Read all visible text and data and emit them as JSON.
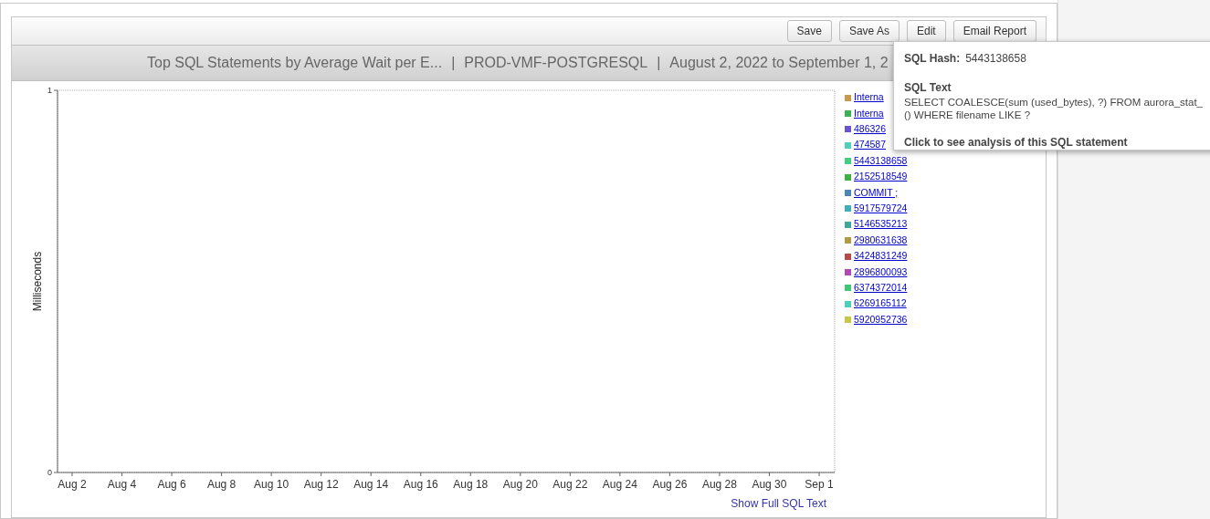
{
  "toolbar": {
    "buttons": [
      "Save",
      "Save As",
      "Edit",
      "Email Report"
    ]
  },
  "report_title": {
    "name": "Top SQL Statements by Average Wait per E...",
    "database": "PROD-VMF-POSTGRESQL",
    "range": "August 2, 2022 to September 1, 2",
    "separator": "|"
  },
  "chart": {
    "chart_data": {
      "type": "line",
      "ylabel": "Milliseconds",
      "categories": [
        "Aug 2",
        "Aug 4",
        "Aug 6",
        "Aug 8",
        "Aug 10",
        "Aug 12",
        "Aug 14",
        "Aug 16",
        "Aug 18",
        "Aug 20",
        "Aug 22",
        "Aug 24",
        "Aug 26",
        "Aug 28",
        "Aug 30",
        "Sep 1"
      ],
      "ylim": [
        0,
        1
      ],
      "yticks": [
        0,
        1
      ]
    }
  },
  "legend": [
    {
      "label": "Interna",
      "color": "#c89a4f"
    },
    {
      "label": "Interna",
      "color": "#3cb054"
    },
    {
      "label": "486326",
      "color": "#6a52d0"
    },
    {
      "label": "474587",
      "color": "#50d0b8"
    },
    {
      "label": "5443138658",
      "color": "#40d080"
    },
    {
      "label": "2152518549",
      "color": "#40b040"
    },
    {
      "label": "COMMIT ;",
      "color": "#4a86b8"
    },
    {
      "label": "5917579724",
      "color": "#40b0b8"
    },
    {
      "label": "5146535213",
      "color": "#40a898"
    },
    {
      "label": "2980631638",
      "color": "#b09a48"
    },
    {
      "label": "3424831249",
      "color": "#b84848"
    },
    {
      "label": "2896800093",
      "color": "#b048b8"
    },
    {
      "label": "6374372014",
      "color": "#40c878"
    },
    {
      "label": "6269165112",
      "color": "#48d0b8"
    },
    {
      "label": "5920952736",
      "color": "#c8c848"
    }
  ],
  "footer_link": "Show Full SQL Text",
  "tooltip": {
    "hash_label": "SQL Hash:",
    "hash": "5443138658",
    "text_label": "SQL Text",
    "text": "SELECT COALESCE(sum (used_bytes), ?) FROM aurora_stat_",
    "text_2": "() WHERE filename LIKE ?",
    "action": "Click to see analysis of this SQL statement"
  }
}
